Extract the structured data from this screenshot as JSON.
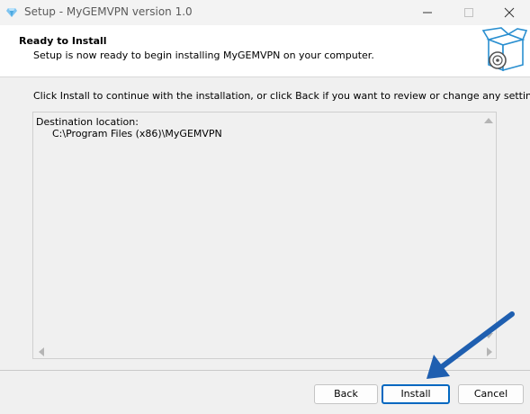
{
  "window": {
    "title": "Setup - MyGEMVPN version 1.0",
    "app_icon": "gem-icon",
    "controls": [
      "minimize-icon",
      "maximize-icon",
      "close-icon"
    ]
  },
  "header": {
    "title": "Ready to Install",
    "subtitle": "Setup is now ready to begin installing MyGEMVPN on your computer.",
    "image": "install-box-icon"
  },
  "instruction": "Click Install to continue with the installation, or click Back if you want to review or change any settings.",
  "memo": {
    "label": "Destination location:",
    "path": "C:\\Program Files (x86)\\MyGEMVPN"
  },
  "buttons": {
    "back": "Back",
    "install": "Install",
    "cancel": "Cancel"
  },
  "annotation": {
    "icon": "arrow-pointer-icon",
    "color": "#1f5fb0"
  }
}
